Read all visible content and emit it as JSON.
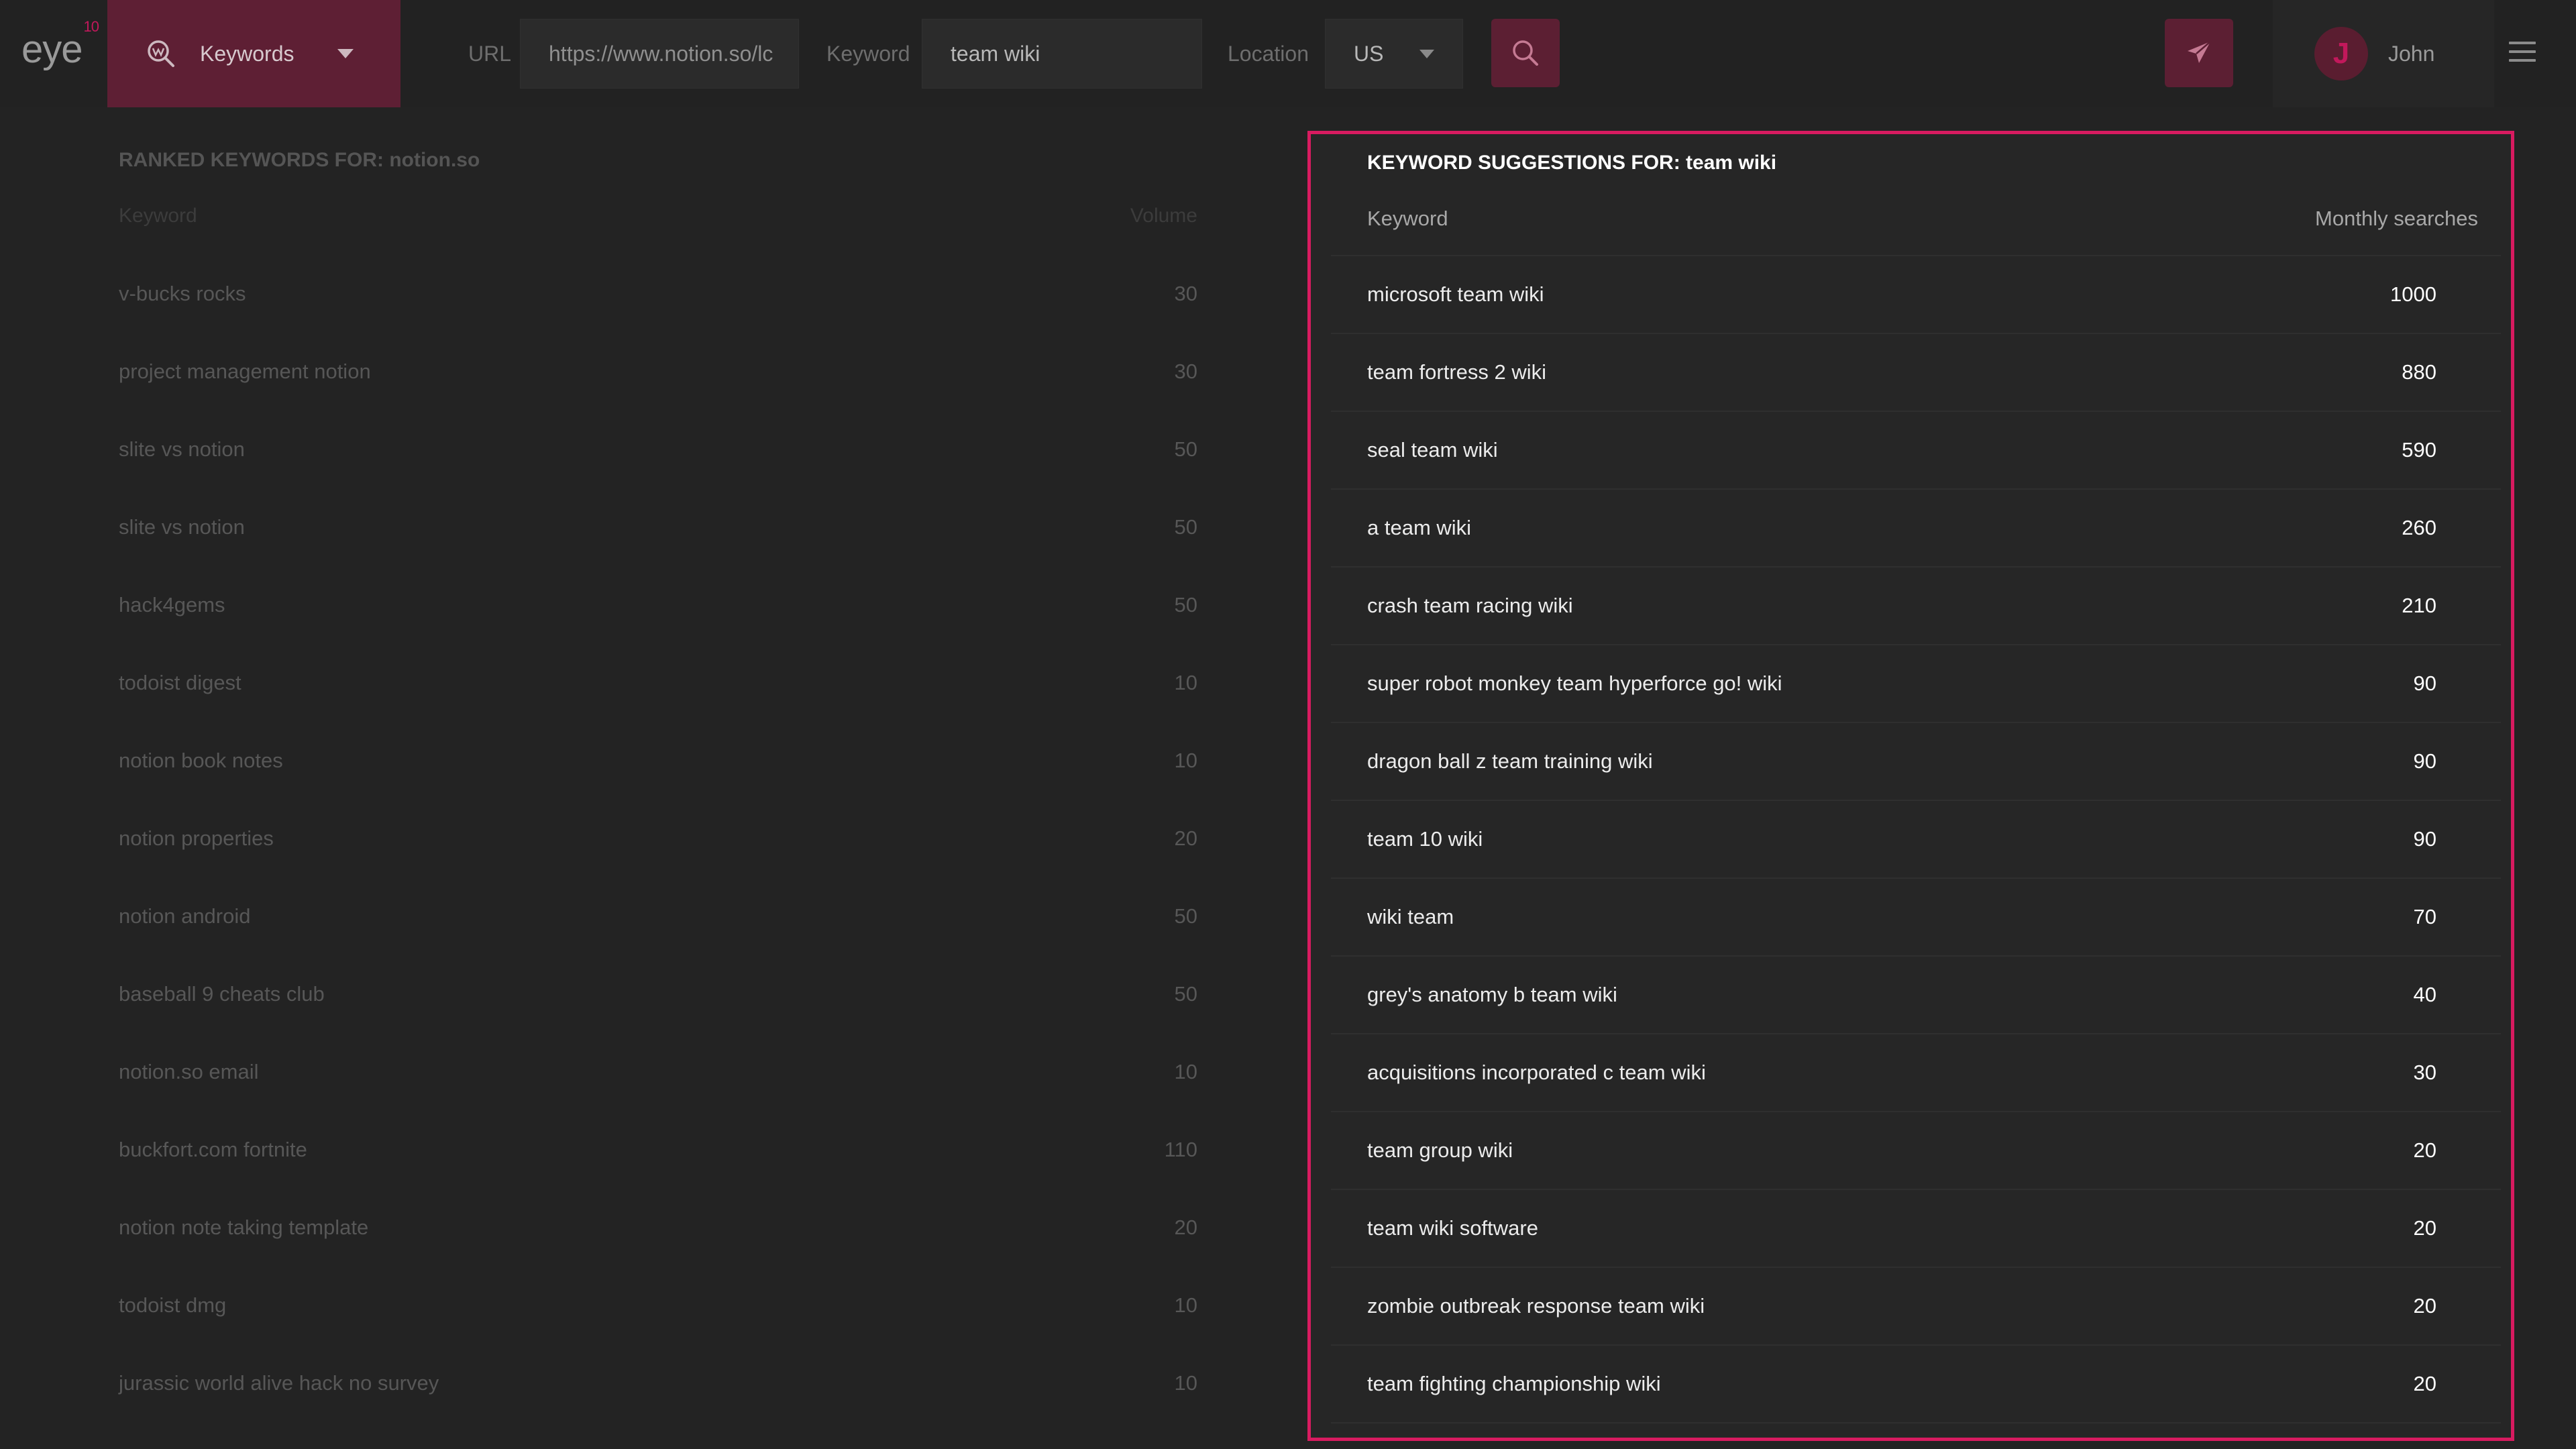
{
  "app": {
    "logo": "eye",
    "logo_sup": "10"
  },
  "toolbar": {
    "tool_label": "Keywords",
    "url_label": "URL",
    "url_value": "https://www.notion.so/lc",
    "keyword_label": "Keyword",
    "keyword_value": "team wiki",
    "location_label": "Location",
    "location_value": "US",
    "user_initial": "J",
    "user_name": "John"
  },
  "icons": {
    "tool": "search-globe-icon",
    "search": "search-icon",
    "send": "paper-plane-icon",
    "menu": "hamburger-icon",
    "caret": "caret-down-icon"
  },
  "colors": {
    "accent": "#d81b60",
    "accent_dark": "#5c1f33",
    "background": "#232323"
  },
  "ranked": {
    "title": "RANKED KEYWORDS FOR: notion.so",
    "col_keyword": "Keyword",
    "col_volume": "Volume",
    "rows": [
      {
        "keyword": "v-bucks rocks",
        "volume": "30"
      },
      {
        "keyword": "project management notion",
        "volume": "30"
      },
      {
        "keyword": "slite vs notion",
        "volume": "50"
      },
      {
        "keyword": "slite vs notion",
        "volume": "50"
      },
      {
        "keyword": "hack4gems",
        "volume": "50"
      },
      {
        "keyword": "todoist digest",
        "volume": "10"
      },
      {
        "keyword": "notion book notes",
        "volume": "10"
      },
      {
        "keyword": "notion properties",
        "volume": "20"
      },
      {
        "keyword": "notion android",
        "volume": "50"
      },
      {
        "keyword": "baseball 9 cheats club",
        "volume": "50"
      },
      {
        "keyword": "notion.so email",
        "volume": "10"
      },
      {
        "keyword": "buckfort.com fortnite",
        "volume": "110"
      },
      {
        "keyword": "notion note taking template",
        "volume": "20"
      },
      {
        "keyword": "todoist dmg",
        "volume": "10"
      },
      {
        "keyword": "jurassic world alive hack no survey",
        "volume": "10"
      }
    ]
  },
  "suggestions": {
    "title": "KEYWORD SUGGESTIONS FOR: team wiki",
    "col_keyword": "Keyword",
    "col_searches": "Monthly searches",
    "rows": [
      {
        "keyword": "microsoft team wiki",
        "searches": "1000"
      },
      {
        "keyword": "team fortress 2 wiki",
        "searches": "880"
      },
      {
        "keyword": "seal team wiki",
        "searches": "590"
      },
      {
        "keyword": "a team wiki",
        "searches": "260"
      },
      {
        "keyword": "crash team racing wiki",
        "searches": "210"
      },
      {
        "keyword": "super robot monkey team hyperforce go! wiki",
        "searches": "90"
      },
      {
        "keyword": "dragon ball z team training wiki",
        "searches": "90"
      },
      {
        "keyword": "team 10 wiki",
        "searches": "90"
      },
      {
        "keyword": "wiki team",
        "searches": "70"
      },
      {
        "keyword": "grey's anatomy b team wiki",
        "searches": "40"
      },
      {
        "keyword": "acquisitions incorporated c team wiki",
        "searches": "30"
      },
      {
        "keyword": "team group wiki",
        "searches": "20"
      },
      {
        "keyword": "team wiki software",
        "searches": "20"
      },
      {
        "keyword": "zombie outbreak response team wiki",
        "searches": "20"
      },
      {
        "keyword": "team fighting championship wiki",
        "searches": "20"
      }
    ]
  }
}
